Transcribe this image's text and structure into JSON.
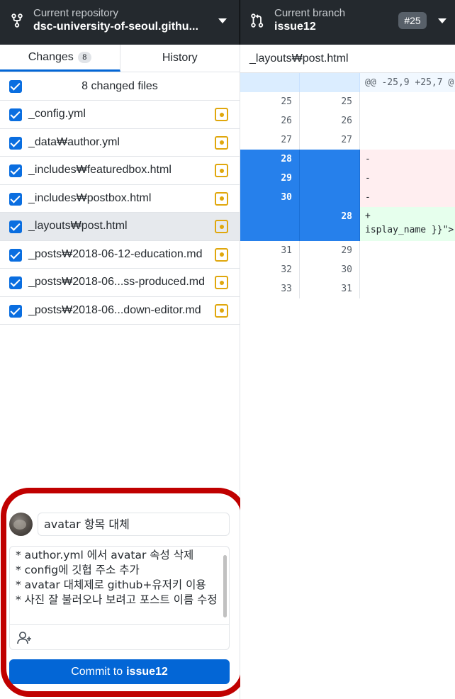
{
  "topbar": {
    "repo": {
      "label": "Current repository",
      "value": "dsc-university-of-seoul.githu...",
      "icon": "repo-fork-icon"
    },
    "branch": {
      "label": "Current branch",
      "value": "issue12",
      "icon": "git-pull-request-icon",
      "pr_badge": "#25"
    }
  },
  "tabs": {
    "changes_label": "Changes",
    "changes_count": "8",
    "history_label": "History"
  },
  "changes": {
    "header_label": "8 changed files",
    "files": [
      {
        "name": "_config.yml",
        "selected": false
      },
      {
        "name": "_data₩author.yml",
        "selected": false
      },
      {
        "name": "_includes₩featuredbox.html",
        "selected": false
      },
      {
        "name": "_includes₩postbox.html",
        "selected": false
      },
      {
        "name": "_layouts₩post.html",
        "selected": true
      },
      {
        "name": "_posts₩2018-06-12-education.md",
        "selected": false
      },
      {
        "name": "_posts₩2018-06...ss-produced.md",
        "selected": false
      },
      {
        "name": "_posts₩2018-06...down-editor.md",
        "selected": false
      }
    ]
  },
  "commit": {
    "summary": "avatar 항목 대체",
    "description": "* author.yml 에서 avatar 속성 삭제\n* config에 깃헙 주소 추가\n* avatar 대체제로 github+유저키 이용\n* 사진 잘 불러오나 보려고 포스트 이름 수정",
    "button_prefix": "Commit to",
    "button_branch": "issue12"
  },
  "diff": {
    "file_path": "_layouts₩post.html",
    "hunk_header": "@@ -25,9 +25,7 @",
    "lines": [
      {
        "old": "25",
        "new": "25",
        "code": "",
        "kind": "ctx"
      },
      {
        "old": "26",
        "new": "26",
        "code": "",
        "kind": "ctx"
      },
      {
        "old": "27",
        "new": "27",
        "code": "",
        "kind": "ctx"
      },
      {
        "old": "28",
        "new": "",
        "code": "-",
        "kind": "del"
      },
      {
        "old": "29",
        "new": "",
        "code": "-",
        "kind": "del"
      },
      {
        "old": "30",
        "new": "",
        "code": "-",
        "kind": "del"
      },
      {
        "old": "",
        "new": "28",
        "code": "+\nisplay_name }}\">",
        "kind": "add"
      },
      {
        "old": "31",
        "new": "29",
        "code": "",
        "kind": "ctx"
      },
      {
        "old": "32",
        "new": "30",
        "code": "",
        "kind": "ctx"
      },
      {
        "old": "33",
        "new": "31",
        "code": "",
        "kind": "ctx"
      }
    ]
  },
  "colors": {
    "topbar_bg": "#24292e",
    "accent_blue": "#0366d6",
    "selection_blue": "#2680eb",
    "modified_yellow": "#e0a70c",
    "annotation_red": "#c00000"
  }
}
